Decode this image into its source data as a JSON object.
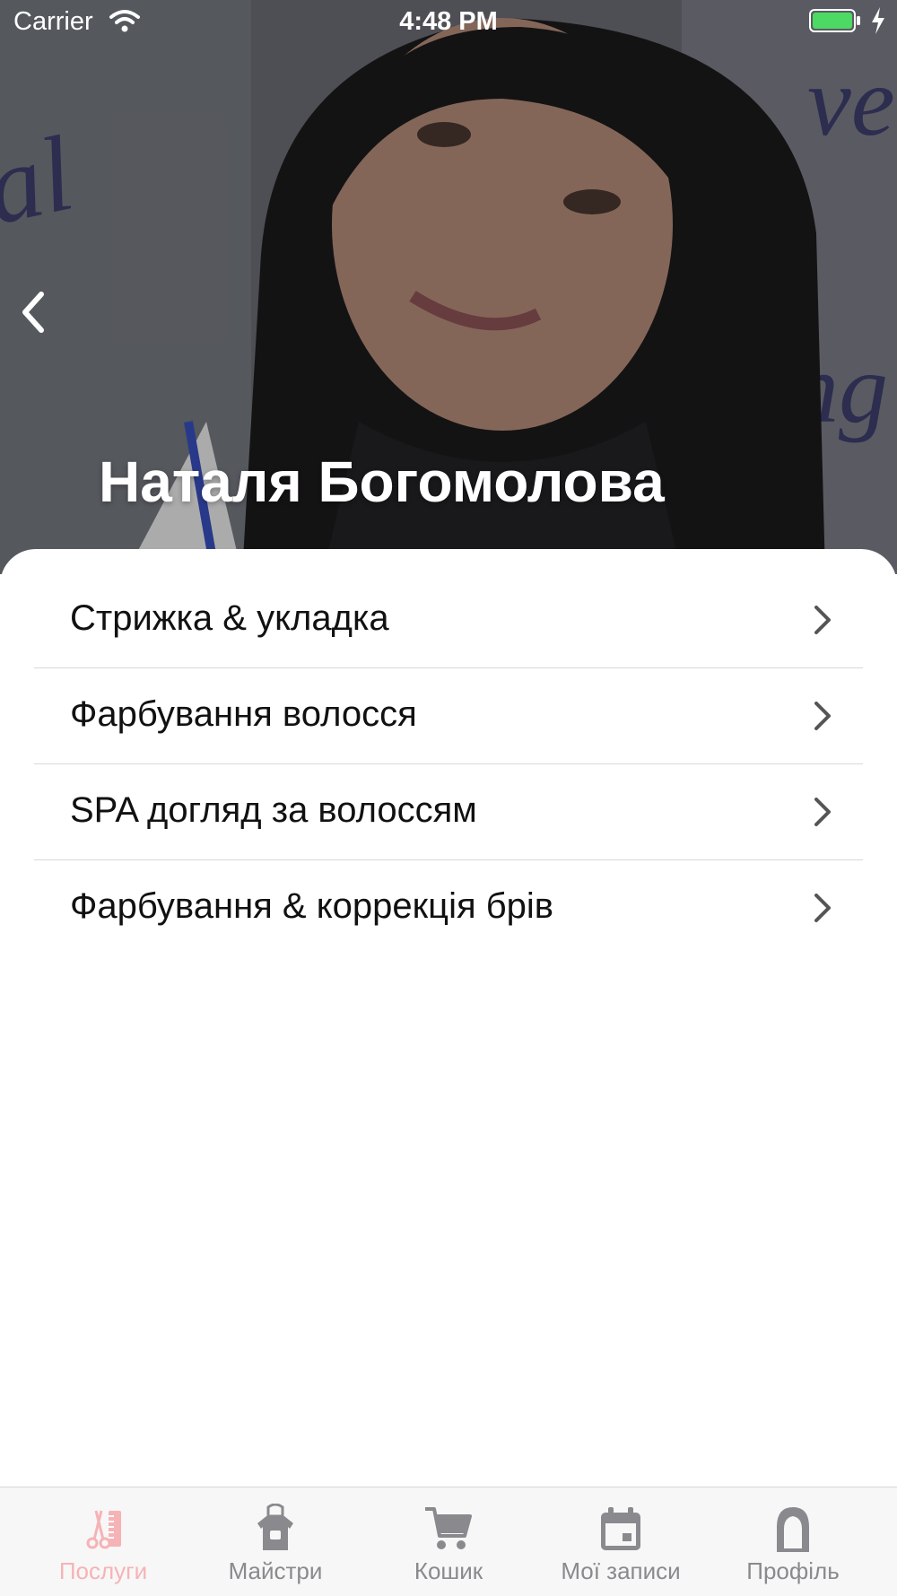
{
  "status_bar": {
    "carrier": "Carrier",
    "time": "4:48 PM"
  },
  "hero": {
    "name": "Наталя Богомолова"
  },
  "services": [
    {
      "label": "Стрижка & укладка"
    },
    {
      "label": "Фарбування волосся"
    },
    {
      "label": "SPA догляд за волоссям"
    },
    {
      "label": "Фарбування & коррекція брів"
    }
  ],
  "tabs": [
    {
      "label": "Послуги",
      "icon": "scissors-comb-icon",
      "active": true
    },
    {
      "label": "Майстри",
      "icon": "apron-icon",
      "active": false
    },
    {
      "label": "Кошик",
      "icon": "cart-icon",
      "active": false
    },
    {
      "label": "Мої записи",
      "icon": "calendar-icon",
      "active": false
    },
    {
      "label": "Профіль",
      "icon": "profile-icon",
      "active": false
    }
  ],
  "colors": {
    "accent": "#f6b3b6",
    "tab_inactive": "#8a8a8e",
    "battery": "#4cd964"
  }
}
